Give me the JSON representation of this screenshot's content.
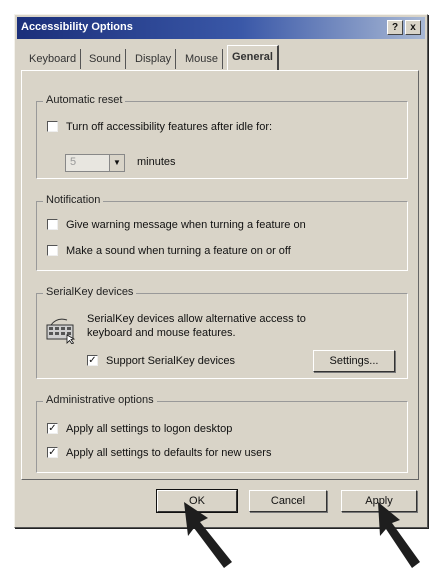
{
  "window": {
    "title": "Accessibility Options",
    "help_label": "?",
    "close_label": "x"
  },
  "tabs": [
    {
      "label": "Keyboard",
      "active": false
    },
    {
      "label": "Sound",
      "active": false
    },
    {
      "label": "Display",
      "active": false
    },
    {
      "label": "Mouse",
      "active": false
    },
    {
      "label": "General",
      "active": true
    }
  ],
  "automatic_reset": {
    "title": "Automatic reset",
    "checkbox_label": "Turn off accessibility features after idle for:",
    "checked": false,
    "idle_value": "5",
    "unit_label": "minutes"
  },
  "notification": {
    "title": "Notification",
    "items": [
      {
        "label": "Give warning message when turning a feature on",
        "checked": false
      },
      {
        "label": "Make a sound when turning a feature on or off",
        "checked": false
      }
    ]
  },
  "serialkey": {
    "title": "SerialKey devices",
    "description_line1": "SerialKey devices allow alternative access to",
    "description_line2": "keyboard and mouse features.",
    "support_label": "Support SerialKey devices",
    "support_checked": true,
    "settings_button": "Settings..."
  },
  "administrative": {
    "title": "Administrative options",
    "items": [
      {
        "label": "Apply all settings to logon desktop",
        "checked": true
      },
      {
        "label": "Apply all settings to defaults for new users",
        "checked": true
      }
    ]
  },
  "footer": {
    "ok_label": "OK",
    "cancel_label": "Cancel",
    "apply_label": "Apply"
  },
  "check_glyph": "✓",
  "icons": [
    "help-icon",
    "close-icon",
    "serialkey-device-icon",
    "pointer-arrow-icon"
  ]
}
